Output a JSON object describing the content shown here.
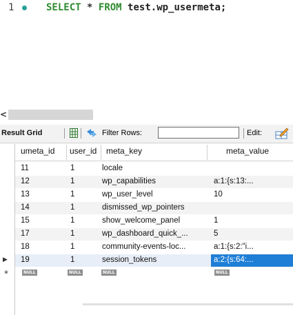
{
  "editor": {
    "line_number": "1",
    "sql_keyword_select": "SELECT",
    "sql_star": "*",
    "sql_keyword_from": "FROM",
    "sql_table": "test.wp_usermeta;",
    "dot_color": "#2aa198"
  },
  "panel": {
    "edge_label": "<"
  },
  "toolbar": {
    "result_grid_label": "Result Grid",
    "grid_icon": "grid-icon",
    "filter_icon": "filter-icon",
    "filter_label": "Filter Rows:",
    "filter_value": "",
    "edit_label": "Edit:",
    "edit_icon": "edit-icon"
  },
  "grid": {
    "columns": [
      "umeta_id",
      "user_id",
      "meta_key",
      "meta_value"
    ],
    "rows": [
      {
        "umeta_id": "11",
        "user_id": "1",
        "meta_key": "locale",
        "meta_value": ""
      },
      {
        "umeta_id": "12",
        "user_id": "1",
        "meta_key": "wp_capabilities",
        "meta_value": "a:1:{s:13:..."
      },
      {
        "umeta_id": "13",
        "user_id": "1",
        "meta_key": "wp_user_level",
        "meta_value": "10"
      },
      {
        "umeta_id": "14",
        "user_id": "1",
        "meta_key": "dismissed_wp_pointers",
        "meta_value": ""
      },
      {
        "umeta_id": "15",
        "user_id": "1",
        "meta_key": "show_welcome_panel",
        "meta_value": "1"
      },
      {
        "umeta_id": "17",
        "user_id": "1",
        "meta_key": "wp_dashboard_quick_...",
        "meta_value": "5"
      },
      {
        "umeta_id": "18",
        "user_id": "1",
        "meta_key": "community-events-loc...",
        "meta_value": "a:1:{s:2:\"i..."
      },
      {
        "umeta_id": "19",
        "user_id": "1",
        "meta_key": "session_tokens",
        "meta_value": "a:2:{s:64:..."
      }
    ],
    "new_row_null": "NULL",
    "current_row_marker": "▶",
    "new_row_marker": "*",
    "selection_color": "#1f7ed6"
  }
}
